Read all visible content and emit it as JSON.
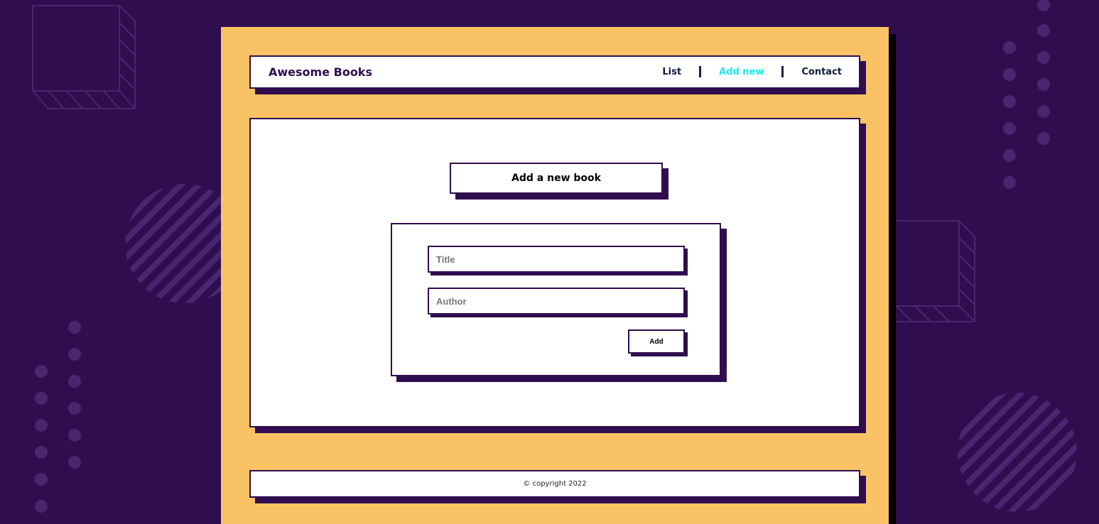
{
  "app": {
    "brand": "Awesome Books"
  },
  "nav": {
    "items": [
      {
        "label": "List",
        "active": false
      },
      {
        "label": "Add new",
        "active": true
      },
      {
        "label": "Contact",
        "active": false
      }
    ]
  },
  "main": {
    "section_title": "Add a new book",
    "form": {
      "title_placeholder": "Title",
      "author_placeholder": "Author",
      "title_value": "",
      "author_value": "",
      "submit_label": "Add"
    }
  },
  "footer": {
    "copyright": "© copyright 2022"
  },
  "colors": {
    "background": "#300d4f",
    "frame": "#f9c264",
    "accent_active": "#15f0f0",
    "panel": "#ffffff",
    "border_shadow": "#300d4f"
  }
}
